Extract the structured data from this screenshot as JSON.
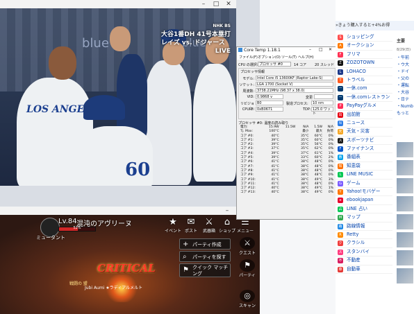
{
  "video": {
    "bug_line1": "大谷1番DH 41号本塁打",
    "bug_line2": "レイズ vs. ドジャース",
    "bug_line3": "LIVE",
    "network": "NHK BS",
    "jersey_text": "LOS ANGELES",
    "bg_text": "blue",
    "number": "60"
  },
  "game": {
    "level": "Lv.84",
    "name": "混沌のアヴリーヌ",
    "hp_label": "52%",
    "hp_fraction": 0.52,
    "class_name": "ミュータント",
    "hud": [
      {
        "glyph": "★",
        "label": "イベント"
      },
      {
        "glyph": "✉",
        "label": "ポスト"
      },
      {
        "glyph": "⚔",
        "label": "武器箱"
      },
      {
        "glyph": "⌂",
        "label": "ショップ"
      },
      {
        "glyph": "☰",
        "label": "メニュー"
      }
    ],
    "buttons": [
      {
        "glyph": "+",
        "label": "パーティ作成"
      },
      {
        "glyph": "⌕",
        "label": "パーティを探す"
      },
      {
        "glyph": "⚑",
        "label": "クイック マッチング"
      }
    ],
    "side": [
      {
        "glyph": "⚔",
        "label": "クエスト"
      },
      {
        "glyph": "⚑",
        "label": "パーティ"
      },
      {
        "glyph": "◎",
        "label": "スキャン"
      }
    ],
    "critical": "CRITICAL",
    "guild_tag": "戦闘の 盟",
    "player_tag": "Jubi Aumi ★ラディアルメルト"
  },
  "coretemp": {
    "title": "Core Temp 1.18.1",
    "menu": [
      "ファイル(F)",
      "オプション(O)",
      "ツール(T)",
      "ヘルプ(H)"
    ],
    "cpu_select_label": "CPU の選択:",
    "cpu_select_value": "プロセッサ #0",
    "cores": "14 コア",
    "threads": "20 スレッド",
    "proc_info_label": "プロセッサ情報",
    "model_label": "モデル:",
    "model": "Intel Core i5 13600KF (Raptor Lake-S)",
    "socket_label": "ソケット:",
    "socket": "LGA 1700 (Socket V)",
    "freq_label": "周波数:",
    "freq": "3738.21MHz (98.37 x 38.0)",
    "vid_label": "VID:",
    "vid": "0.9868 v",
    "mod_label": "変更",
    "rev_label": "リビジョン:",
    "rev": "B0",
    "lith_label": "製造プロセス:",
    "lith": "10 nm",
    "cpuid_label": "CPUID:",
    "cpuid": "0xB0671",
    "tdp_label": "TDP:",
    "tdp": "125.0 ワット",
    "temp_label": "プロセッサ #0: 温度の読み取り",
    "columns": [
      "",
      "",
      "最小",
      "最大",
      "負荷"
    ],
    "power_row": [
      "電力:",
      "15.9W",
      "11.5W",
      "N/A",
      "1.5W",
      "N/A"
    ],
    "tj_row": [
      "Tj. Max:",
      "100°C",
      "",
      "最小",
      "最大",
      "負荷"
    ],
    "rows": [
      [
        "コア #0:",
        "40°C",
        "",
        "35°C",
        "60°C",
        "0%"
      ],
      [
        "コア #1:",
        "39°C",
        "",
        "35°C",
        "60°C",
        "0%"
      ],
      [
        "コア #2:",
        "39°C",
        "",
        "35°C",
        "56°C",
        "0%"
      ],
      [
        "コア #3:",
        "37°C",
        "",
        "35°C",
        "62°C",
        "0%"
      ],
      [
        "コア #4:",
        "39°C",
        "",
        "37°C",
        "61°C",
        "1%"
      ],
      [
        "コア #5:",
        "39°C",
        "",
        "33°C",
        "60°C",
        "2%"
      ],
      [
        "コア #6:",
        "41°C",
        "",
        "38°C",
        "48°C",
        "0%"
      ],
      [
        "コア #7:",
        "41°C",
        "",
        "38°C",
        "48°C",
        "0%"
      ],
      [
        "コア #8:",
        "41°C",
        "",
        "38°C",
        "48°C",
        "0%"
      ],
      [
        "コア #9:",
        "41°C",
        "",
        "38°C",
        "48°C",
        "0%"
      ],
      [
        "コア #10:",
        "41°C",
        "",
        "38°C",
        "49°C",
        "3%"
      ],
      [
        "コア #11:",
        "41°C",
        "",
        "38°C",
        "48°C",
        "0%"
      ],
      [
        "コア #12:",
        "40°C",
        "",
        "38°C",
        "49°C",
        "1%"
      ],
      [
        "コア #13:",
        "40°C",
        "",
        "38°C",
        "49°C",
        "0%"
      ]
    ]
  },
  "yahoo": {
    "promo": "»きょう購入すると+4%お得",
    "services": [
      {
        "label": "ショッピング",
        "color": "#ff4d4d",
        "icon": "S"
      },
      {
        "label": "オークション",
        "color": "#ff7b00",
        "icon": "A"
      },
      {
        "label": "フリマ",
        "color": "#ff3355",
        "icon": "F"
      },
      {
        "label": "ZOZOTOWN",
        "color": "#111111",
        "icon": "Z"
      },
      {
        "label": "LOHACO",
        "color": "#1e3a8a",
        "icon": "L"
      },
      {
        "label": "トラベル",
        "color": "#ff5a1f",
        "icon": "T"
      },
      {
        "label": "一休.com",
        "color": "#003a70",
        "icon": "一"
      },
      {
        "label": "一休.comレストラン",
        "color": "#003a70",
        "icon": "一"
      },
      {
        "label": "PayPayグルメ",
        "color": "#ff2d55",
        "icon": "P"
      },
      {
        "label": "出前館",
        "color": "#e60012",
        "icon": "出"
      },
      {
        "label": "ニュース",
        "color": "#2c7be5",
        "icon": "N"
      },
      {
        "label": "天気・災害",
        "color": "#f5a623",
        "icon": "天"
      },
      {
        "label": "スポーツナビ",
        "color": "#1b1b1b",
        "icon": "ス"
      },
      {
        "label": "ファイナンス",
        "color": "#0a58ca",
        "icon": "F"
      },
      {
        "label": "番組表",
        "color": "#00a0e9",
        "icon": "番"
      },
      {
        "label": "知恵袋",
        "color": "#ff6f00",
        "icon": "知"
      },
      {
        "label": "LINE MUSIC",
        "color": "#06c755",
        "icon": "L"
      },
      {
        "label": "ゲーム",
        "color": "#7b5cff",
        "icon": "G"
      },
      {
        "label": "Yahoo!モバゲー",
        "color": "#ff7700",
        "icon": "Y"
      },
      {
        "label": "ebookjapan",
        "color": "#e6002d",
        "icon": "e"
      },
      {
        "label": "LINE 占い",
        "color": "#06c755",
        "icon": "占"
      },
      {
        "label": "マップ",
        "color": "#2fa84f",
        "icon": "M"
      },
      {
        "label": "路線情報",
        "color": "#1e88e5",
        "icon": "路"
      },
      {
        "label": "Retty",
        "color": "#ff8a00",
        "icon": "R"
      },
      {
        "label": "クラシル",
        "color": "#f03c3c",
        "icon": "ク"
      },
      {
        "label": "スタンバイ",
        "color": "#ff3b7f",
        "icon": "ス"
      },
      {
        "label": "不動産",
        "color": "#d81b60",
        "icon": "不"
      },
      {
        "label": "自動車",
        "color": "#e53935",
        "icon": "車"
      }
    ],
    "news_tab": "主要",
    "news_date": "8/29(日)",
    "news": [
      "・午前",
      "・ウ大",
      "・ドイ",
      "・父の",
      "・運転",
      "・大谷",
      "・日テ",
      "・Numb",
      "もっと"
    ]
  }
}
